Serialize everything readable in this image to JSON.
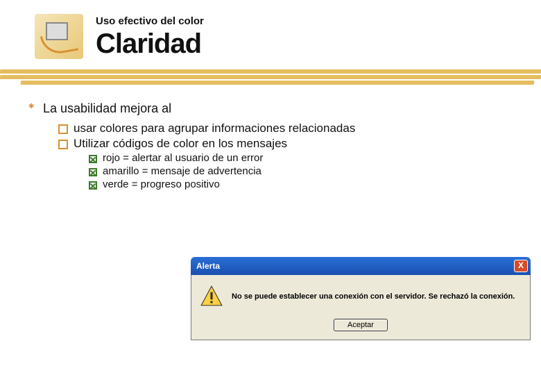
{
  "header": {
    "pretitle": "Uso efectivo del color",
    "title": "Claridad"
  },
  "content": {
    "heading": "La usabilidad mejora al",
    "points": [
      "usar colores para agrupar informaciones relacionadas",
      "Utilizar códigos de color en los mensajes"
    ],
    "examples": [
      "rojo = alertar al usuario de un error",
      "amarillo = mensaje de advertencia",
      "verde = progreso positivo"
    ]
  },
  "dialog": {
    "title": "Alerta",
    "message": "No se puede establecer una conexión con el servidor. Se rechazó la conexión.",
    "accept": "Aceptar",
    "close_glyph": "X"
  }
}
